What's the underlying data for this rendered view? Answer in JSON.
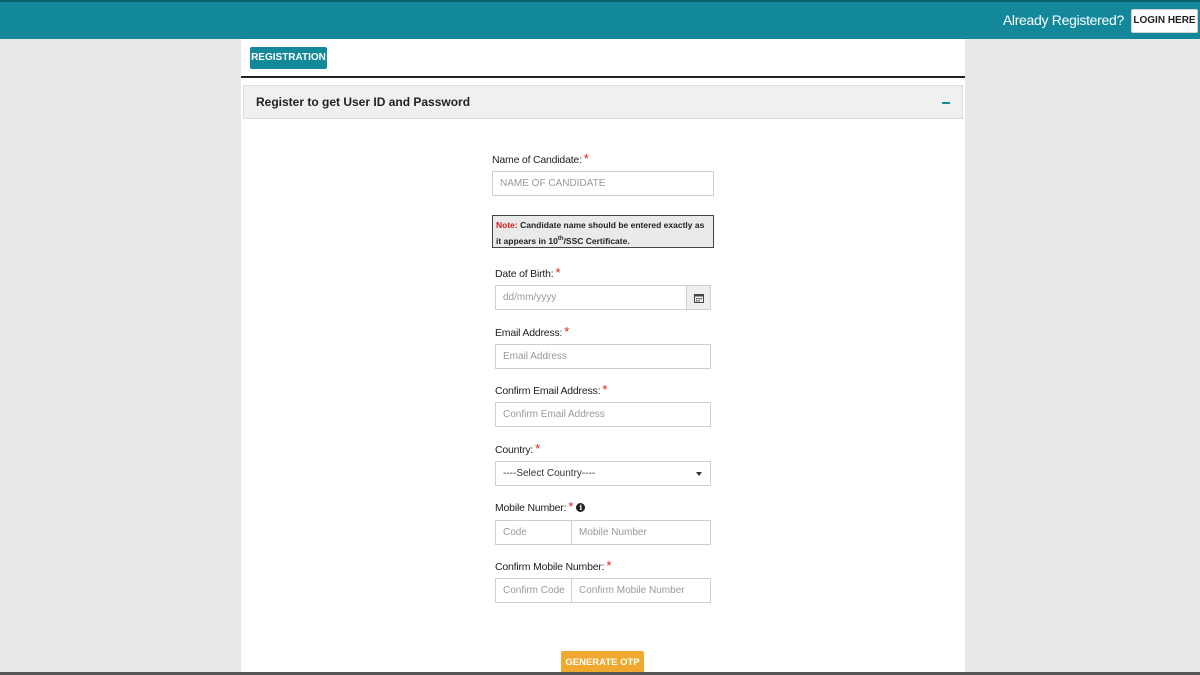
{
  "header": {
    "already_registered": "Already Registered?",
    "login_label": "LOGIN HERE"
  },
  "tab": {
    "label": "REGISTRATION"
  },
  "section": {
    "title": "Register to get User ID and Password",
    "collapse_symbol": "−"
  },
  "form": {
    "name": {
      "label": "Name of Candidate:",
      "placeholder": "NAME OF CANDIDATE"
    },
    "note": {
      "prefix": "Note:",
      "text_a": " Candidate name should be entered exactly as it appears in 10",
      "sup": "th",
      "text_b": "/SSC Certificate."
    },
    "dob": {
      "label": "Date of Birth:",
      "placeholder": "dd/mm/yyyy"
    },
    "email": {
      "label": "Email Address:",
      "placeholder": "Email Address"
    },
    "confirm_email": {
      "label": "Confirm Email Address:",
      "placeholder": "Confirm Email Address"
    },
    "country": {
      "label": "Country:",
      "selected": "----Select Country----"
    },
    "mobile": {
      "label": "Mobile Number:",
      "code_placeholder": "Code",
      "number_placeholder": "Mobile Number"
    },
    "confirm_mobile": {
      "label": "Confirm Mobile Number:",
      "code_placeholder": "Confirm Code",
      "number_placeholder": "Confirm Mobile Number"
    },
    "required_marker": "*",
    "submit_label": "GENERATE OTP"
  },
  "colors": {
    "primary": "#13889b",
    "accent": "#f0a92e",
    "required": "#d91b1b"
  },
  "icons": {
    "calendar": "calendar-icon",
    "dropdown": "chevron-down-icon",
    "info": "info-icon"
  }
}
